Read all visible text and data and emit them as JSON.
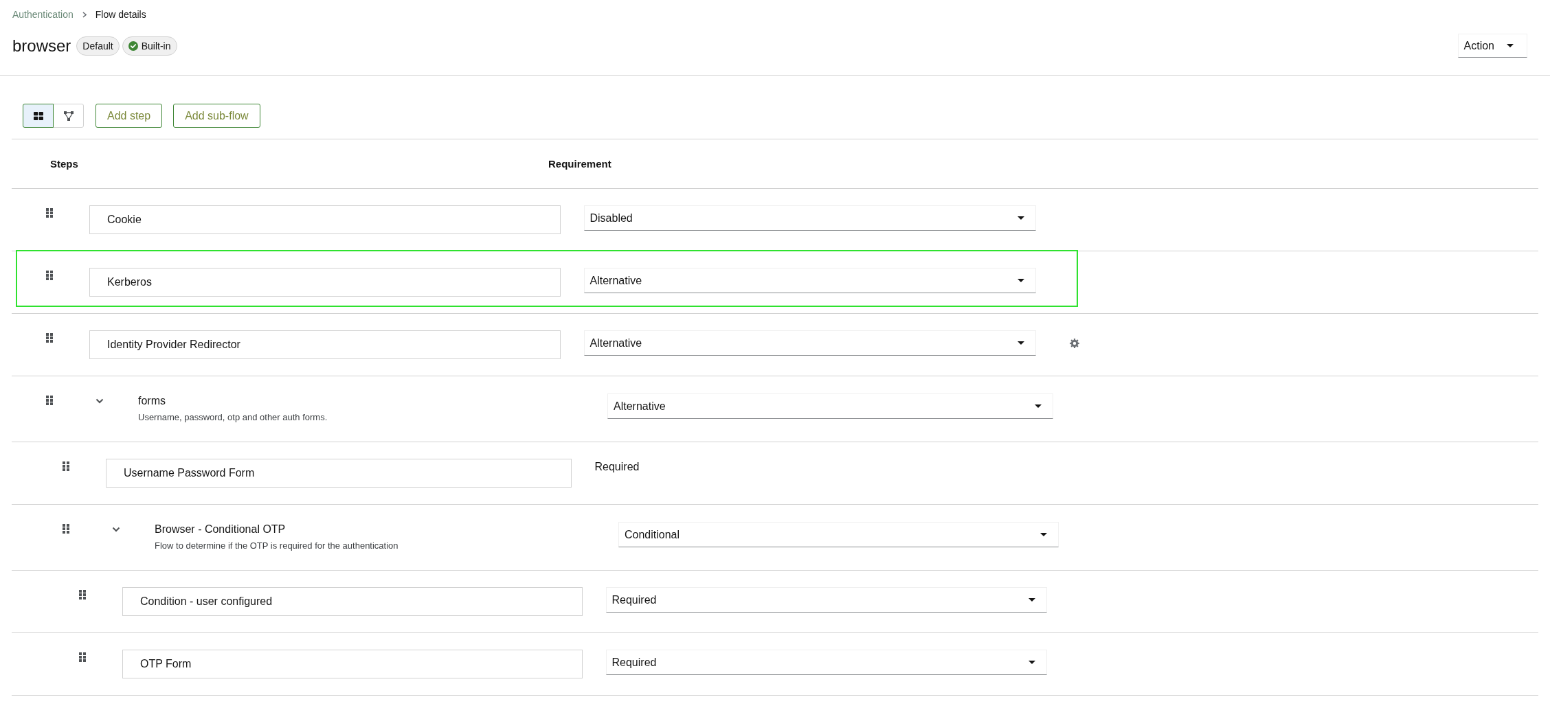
{
  "breadcrumb": [
    {
      "label": "Authentication",
      "kind": "link"
    },
    {
      "label": "Flow details",
      "kind": "current"
    }
  ],
  "title": "browser",
  "badges": [
    {
      "label": "Default",
      "kind": "plain"
    },
    {
      "label": "Built-in",
      "kind": "verified"
    }
  ],
  "action_menu": {
    "label": "Action"
  },
  "view_toggles": [
    {
      "kind": "table",
      "selected": true
    },
    {
      "kind": "diagram",
      "selected": false
    }
  ],
  "toolbar_buttons": [
    "Add step",
    "Add sub-flow"
  ],
  "columns": [
    "Steps",
    "Requirement"
  ],
  "steps": [
    {
      "kind": "execution",
      "name": "Cookie",
      "requirement": {
        "kind": "dropdown",
        "value": "Disabled"
      },
      "configurable": false,
      "highlighted": false
    },
    {
      "kind": "execution",
      "name": "Kerberos",
      "requirement": {
        "kind": "dropdown",
        "value": "Alternative"
      },
      "configurable": false,
      "highlighted": true
    },
    {
      "kind": "execution",
      "name": "Identity Provider Redirector",
      "requirement": {
        "kind": "dropdown",
        "value": "Alternative"
      },
      "configurable": true,
      "highlighted": false
    },
    {
      "kind": "flow",
      "name": "forms",
      "description": "Username, password, otp and other auth forms.",
      "requirement": {
        "kind": "dropdown",
        "value": "Alternative"
      },
      "configurable": false,
      "highlighted": false,
      "expanded": true,
      "children": [
        {
          "kind": "execution",
          "name": "Username Password Form",
          "requirement": {
            "kind": "label",
            "value": "Required"
          },
          "configurable": false,
          "highlighted": false
        },
        {
          "kind": "flow",
          "name": "Browser - Conditional OTP",
          "description": "Flow to determine if the OTP is required for the authentication",
          "requirement": {
            "kind": "dropdown",
            "value": "Conditional"
          },
          "configurable": false,
          "highlighted": false,
          "expanded": true,
          "children": [
            {
              "kind": "execution",
              "name": "Condition - user configured",
              "requirement": {
                "kind": "dropdown",
                "value": "Required"
              },
              "configurable": false,
              "highlighted": false
            },
            {
              "kind": "execution",
              "name": "OTP Form",
              "requirement": {
                "kind": "dropdown",
                "value": "Required"
              },
              "configurable": false,
              "highlighted": false
            }
          ]
        }
      ]
    }
  ]
}
